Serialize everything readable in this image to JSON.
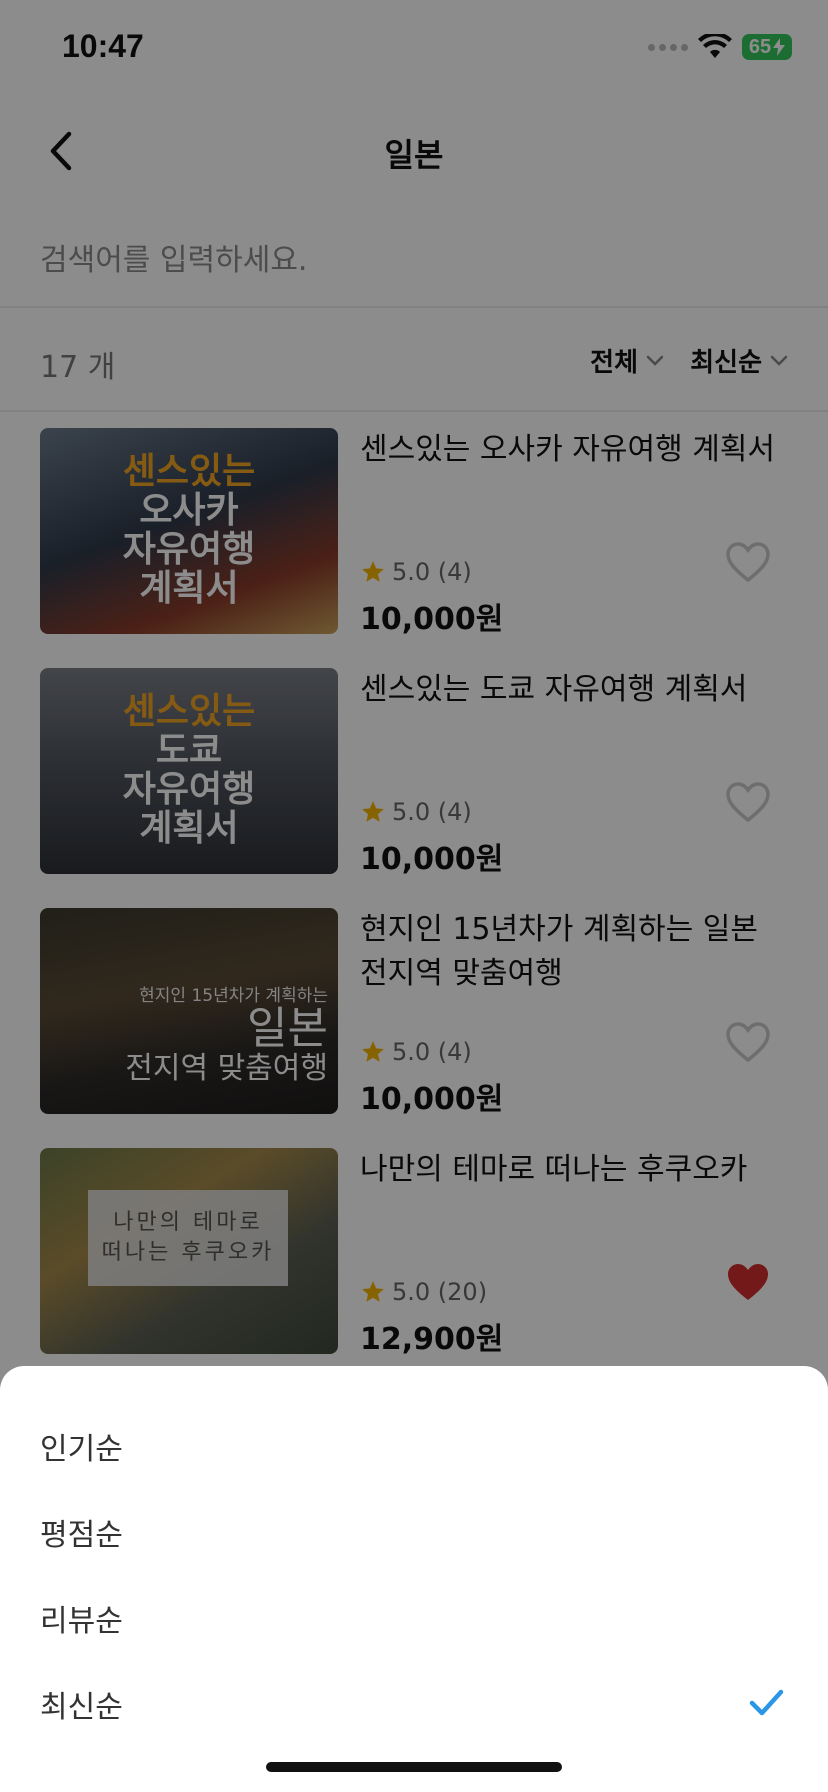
{
  "status_bar": {
    "time": "10:47",
    "battery": "65"
  },
  "header": {
    "title": "일본",
    "back_icon": "chevron-left-icon"
  },
  "search": {
    "placeholder": "검색어를 입력하세요."
  },
  "filter": {
    "count": "17 개",
    "category_label": "전체",
    "sort_label": "최신순"
  },
  "items": [
    {
      "thumb_lines": [
        "센스있는",
        "오사카",
        "자유여행",
        "계획서"
      ],
      "title": "센스있는 오사카 자유여행 계획서",
      "rating": "5.0 (4)",
      "price": "10,000원",
      "liked": false
    },
    {
      "thumb_lines": [
        "센스있는",
        "도쿄",
        "자유여행",
        "계획서"
      ],
      "title": "센스있는 도쿄 자유여행 계획서",
      "rating": "5.0 (4)",
      "price": "10,000원",
      "liked": false
    },
    {
      "thumb_lines": [
        "현지인 15년차가 계획하는",
        "일본",
        "전지역 맞춤여행"
      ],
      "title": "현지인 15년차가 계획하는 일본 전지역 맞춤여행",
      "rating": "5.0 (4)",
      "price": "10,000원",
      "liked": false
    },
    {
      "thumb_lines": [
        "나만의 테마로",
        "떠나는 후쿠오카"
      ],
      "title": "나만의 테마로 떠나는 후쿠오카",
      "rating": "5.0 (20)",
      "price": "12,900원",
      "liked": true
    }
  ],
  "sort_sheet": {
    "options": [
      {
        "label": "인기순",
        "selected": false
      },
      {
        "label": "평점순",
        "selected": false
      },
      {
        "label": "리뷰순",
        "selected": false
      },
      {
        "label": "최신순",
        "selected": true
      }
    ]
  },
  "colors": {
    "accent": "#2a96e6",
    "star": "#f5b400",
    "heart_active": "#d32f2f",
    "heart_inactive": "#c8c8c8",
    "overlay": "rgba(0,0,0,0.45)"
  }
}
